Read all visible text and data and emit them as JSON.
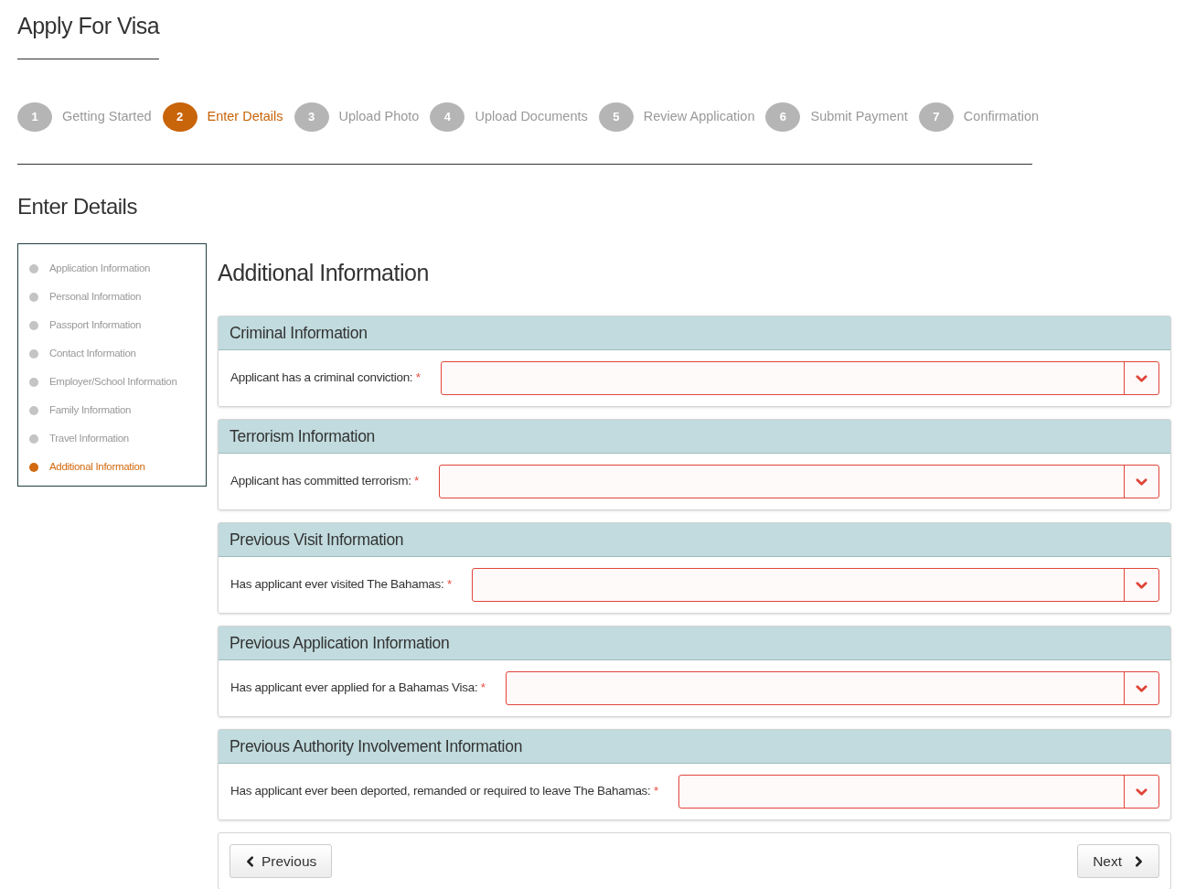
{
  "page_title": "Apply For Visa",
  "steps": [
    {
      "number": "1",
      "label": "Getting Started",
      "selected": false
    },
    {
      "number": "2",
      "label": "Enter Details",
      "selected": true
    },
    {
      "number": "3",
      "label": "Upload Photo",
      "selected": false
    },
    {
      "number": "4",
      "label": "Upload Documents",
      "selected": false
    },
    {
      "number": "5",
      "label": "Review Application",
      "selected": false
    },
    {
      "number": "6",
      "label": "Submit Payment",
      "selected": false
    },
    {
      "number": "7",
      "label": "Confirmation",
      "selected": false
    }
  ],
  "section_title": "Enter Details",
  "sidebar": {
    "items": [
      {
        "label": "Application Information",
        "selected": false
      },
      {
        "label": "Personal Information",
        "selected": false
      },
      {
        "label": "Passport Information",
        "selected": false
      },
      {
        "label": "Contact Information",
        "selected": false
      },
      {
        "label": "Employer/School Information",
        "selected": false
      },
      {
        "label": "Family Information",
        "selected": false
      },
      {
        "label": "Travel Information",
        "selected": false
      },
      {
        "label": "Additional Information",
        "selected": true
      }
    ]
  },
  "form_title": "Additional Information",
  "panels": [
    {
      "title": "Criminal Information",
      "label": "Applicant has a criminal conviction:",
      "required_mark": "*"
    },
    {
      "title": "Terrorism Information",
      "label": "Applicant has committed terrorism:",
      "required_mark": "*"
    },
    {
      "title": "Previous Visit Information",
      "label": "Has applicant ever visited The Bahamas:",
      "required_mark": "*"
    },
    {
      "title": "Previous Application Information",
      "label": "Has applicant ever applied for a Bahamas Visa:",
      "required_mark": "*"
    },
    {
      "title": "Previous Authority Involvement Information",
      "label": "Has applicant ever been deported, remanded or required to leave The Bahamas:",
      "required_mark": "*"
    }
  ],
  "buttons": {
    "previous": "Previous",
    "next": "Next"
  }
}
